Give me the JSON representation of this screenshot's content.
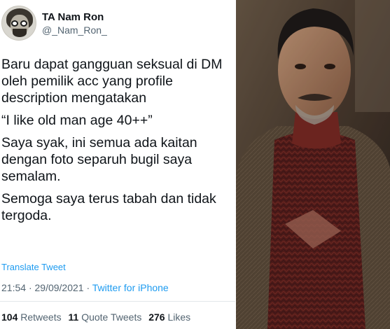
{
  "user": {
    "display_name": "TA Nam Ron",
    "handle": "@_Nam_Ron_"
  },
  "tweet": {
    "paragraphs": [
      "Baru dapat gangguan seksual di DM oleh pemilik acc yang profile description mengatakan",
      "“I like old man age 40++”",
      "Saya syak, ini semua ada kaitan dengan foto separuh bugil saya semalam.",
      "Semoga saya terus tabah dan tidak tergoda."
    ],
    "translate_label": "Translate Tweet",
    "time": "21:54",
    "date": "29/09/2021",
    "separator": "·",
    "source": "Twitter for iPhone"
  },
  "stats": {
    "retweets_count": "104",
    "retweets_label": "Retweets",
    "quotes_count": "11",
    "quotes_label": "Quote Tweets",
    "likes_count": "276",
    "likes_label": "Likes"
  },
  "colors": {
    "link": "#1d9bf0",
    "secondary_text": "#536471",
    "primary_text": "#0f1419"
  },
  "icons": {
    "avatar": "profile-avatar"
  }
}
